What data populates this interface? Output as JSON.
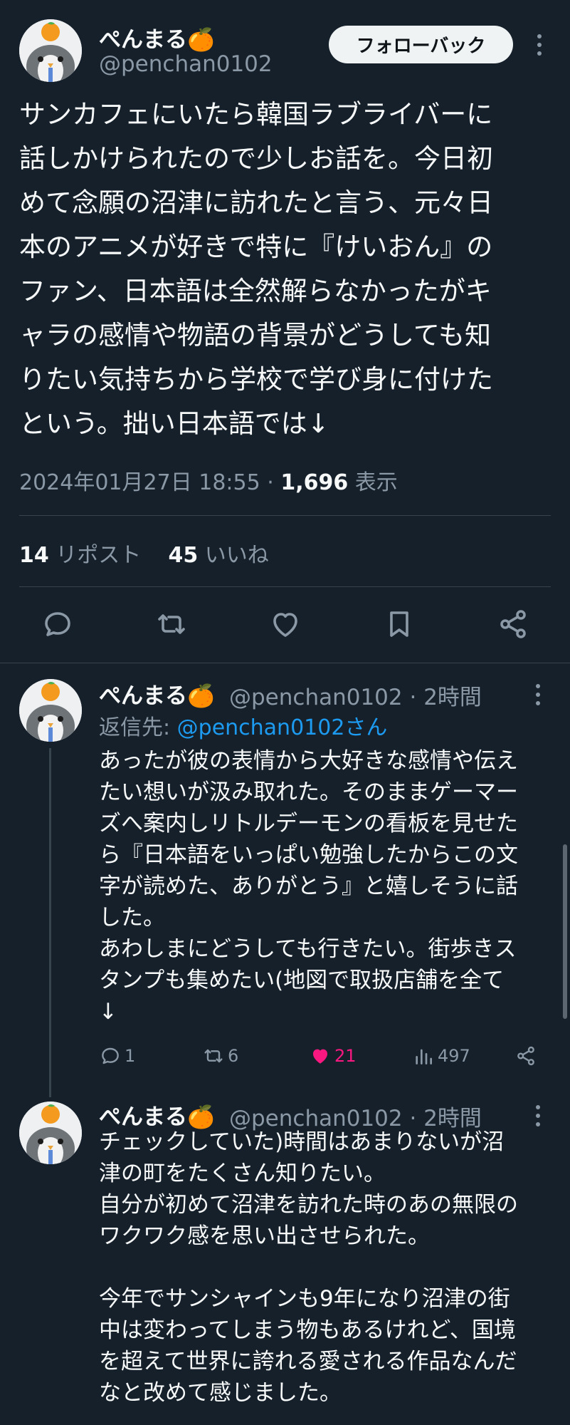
{
  "colors": {
    "background": "#15202b",
    "text": "#f7f9f9",
    "secondary": "#8b98a5",
    "link": "#1d9bf0",
    "like": "#f91880",
    "divider": "#38444d"
  },
  "main_tweet": {
    "author_name": "ぺんまる🍊",
    "handle": "@penchan0102",
    "follow_label": "フォローバック",
    "text": "サンカフェにいたら韓国ラブライバーに\n話しかけられたので少しお話を。今日初\nめて念願の沼津に訪れたと言う、元々日\n本のアニメが好きで特に『けいおん』の\nファン、日本語は全然解らなかったがキ\nャラの感情や物語の背景がどうしても知\nりたい気持ちから学校で学び身に付けた\nという。拙い日本語では↓",
    "timestamp": "2024年01月27日 18:55",
    "separator": "·",
    "views_count": "1,696",
    "views_label": "表示",
    "reposts_count": "14",
    "reposts_label": "リポスト",
    "likes_count": "45",
    "likes_label": "いいね",
    "icons": [
      "reply-icon",
      "repost-icon",
      "like-icon",
      "bookmark-icon",
      "share-icon"
    ]
  },
  "replies": [
    {
      "author_name": "ぺんまる🍊",
      "handle": "@penchan0102",
      "time": "· 2時間",
      "reply_to_label": "返信先:",
      "reply_to_mention": "@penchan0102さん",
      "text": "あったが彼の表情から大好きな感情や伝え\nたい想いが汲み取れた。そのままゲーマー\nズへ案内しリトルデーモンの看板を見せた\nら『日本語をいっぱい勉強したからこの文\n字が読めた、ありがとう』と嬉しそうに話\nした。\nあわしまにどうしても行きたい。街歩きス\nタンプも集めたい(地図で取扱店舗を全て\n↓",
      "replies_count": "1",
      "reposts_count": "6",
      "likes_count": "21",
      "views_count": "497"
    },
    {
      "author_name": "ぺんまる🍊",
      "handle": "@penchan0102",
      "time": "· 2時間",
      "text": "チェックしていた)時間はあまりないが沼\n津の町をたくさん知りたい。\n自分が初めて沼津を訪れた時のあの無限の\nワクワク感を思い出させられた。\n\n今年でサンシャインも9年になり沼津の街\n中は変わってしまう物もあるけれど、国境\nを超えて世界に誇れる愛される作品なんだ\nなと改めて感じました。"
    }
  ]
}
